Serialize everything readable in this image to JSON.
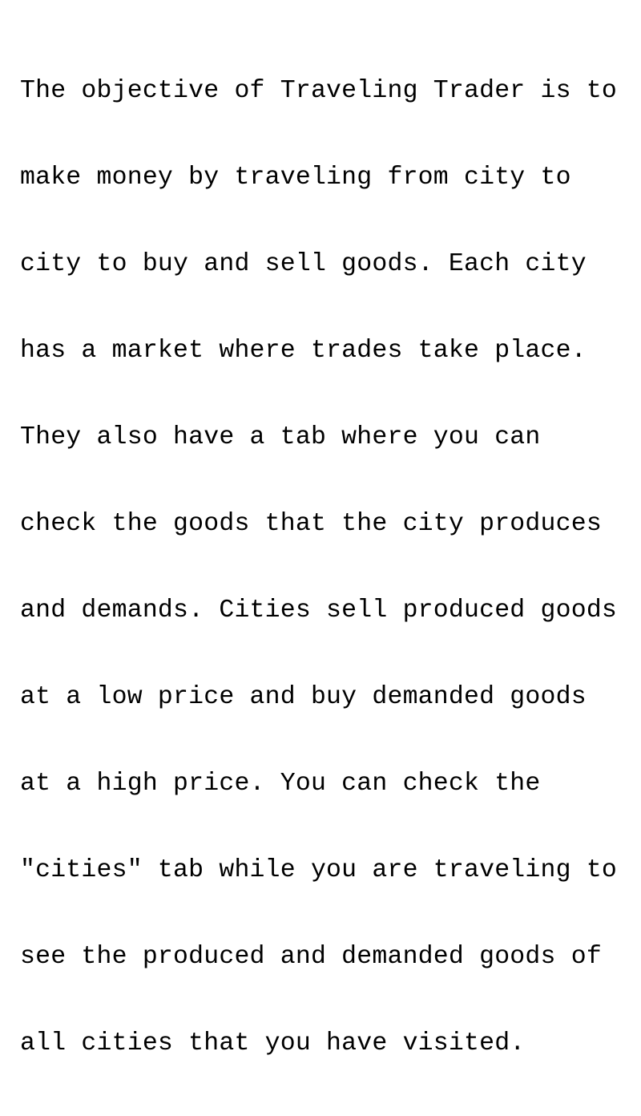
{
  "help_screen": {
    "lines": [
      "The objective of Traveling Trader is to",
      "make money by traveling from city to",
      "city to buy and sell goods. Each city",
      "has a market where trades take place.",
      "They also have a tab where you can",
      "check the goods that the city produces",
      "and demands. Cities sell produced goods",
      "at a low price and buy demanded goods",
      "at a high price. You can check the",
      "\"cities\" tab while you are traveling to",
      "see the produced and demanded goods of",
      "all cities that you have visited."
    ]
  }
}
